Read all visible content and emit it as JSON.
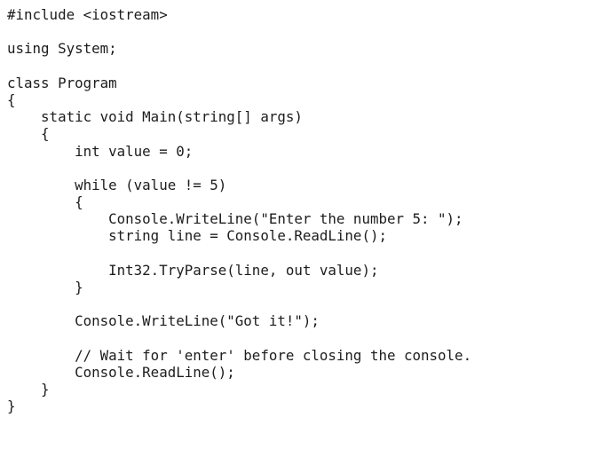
{
  "document": {
    "lines": [
      "#include <iostream>",
      "",
      "using System;",
      "",
      "class Program",
      "{",
      "    static void Main(string[] args)",
      "    {",
      "        int value = 0;",
      "",
      "        while (value != 5)",
      "        {",
      "            Console.WriteLine(\"Enter the number 5: \");",
      "            string line = Console.ReadLine();",
      "",
      "            Int32.TryParse(line, out value);",
      "        }",
      "",
      "        Console.WriteLine(\"Got it!\");",
      "",
      "        // Wait for 'enter' before closing the console.",
      "        Console.ReadLine();",
      "    }",
      "}"
    ]
  }
}
